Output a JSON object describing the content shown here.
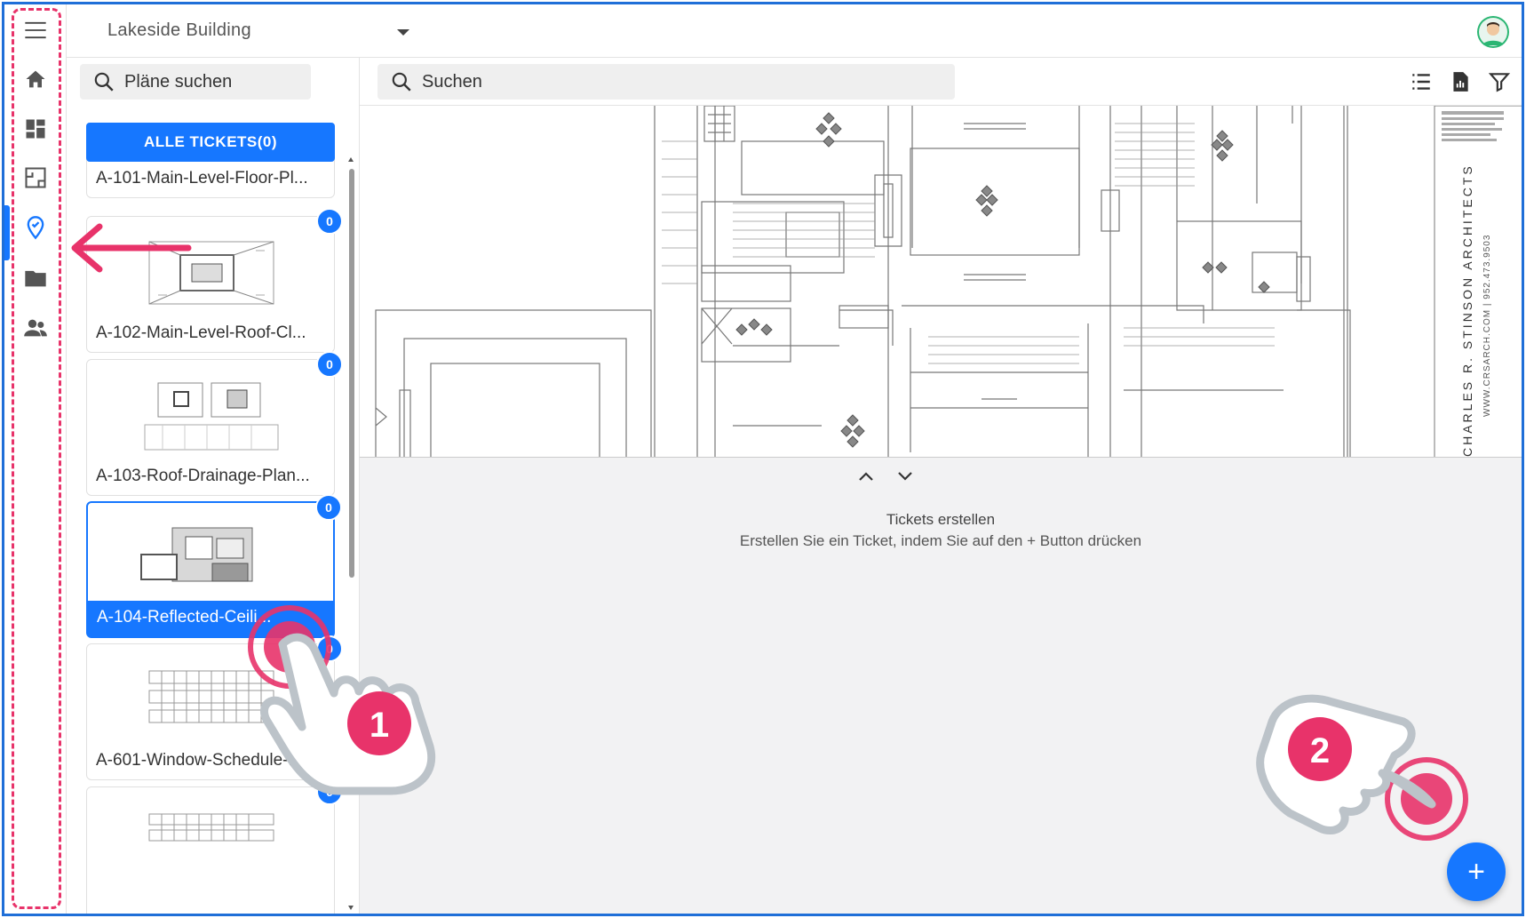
{
  "header": {
    "project_title": "Lakeside Building"
  },
  "plans": {
    "search_placeholder": "Pläne suchen",
    "all_tickets_label": "ALLE TICKETS(0)",
    "items": [
      {
        "label": "A-101-Main-Level-Floor-Pl...",
        "badge": ""
      },
      {
        "label": "A-102-Main-Level-Roof-Cl...",
        "badge": "0"
      },
      {
        "label": "A-103-Roof-Drainage-Plan...",
        "badge": "0"
      },
      {
        "label": "A-104-Reflected-Ceili...",
        "badge": "0"
      },
      {
        "label": "A-601-Window-Schedule-...",
        "badge": "0"
      },
      {
        "label": "",
        "badge": "0"
      }
    ]
  },
  "main": {
    "search_placeholder": "Suchen",
    "empty_title": "Tickets erstellen",
    "empty_subtitle": "Erstellen Sie ein Ticket, indem Sie auf den + Button drücken",
    "fab_label": "+",
    "drawing_title": "CHARLES R. STINSON ARCHITECTS",
    "drawing_subtitle": "WWW.CRSARCH.COM | 952.473.9503"
  },
  "annotations": {
    "step1": "1",
    "step2": "2"
  },
  "colors": {
    "accent": "#1677ff",
    "annotation": "#e8336a"
  },
  "icons": [
    "menu-icon",
    "home-icon",
    "dashboard-icon",
    "plans-icon",
    "tickets-icon",
    "folder-icon",
    "people-icon",
    "search-icon",
    "list-icon",
    "report-icon",
    "filter-icon"
  ]
}
